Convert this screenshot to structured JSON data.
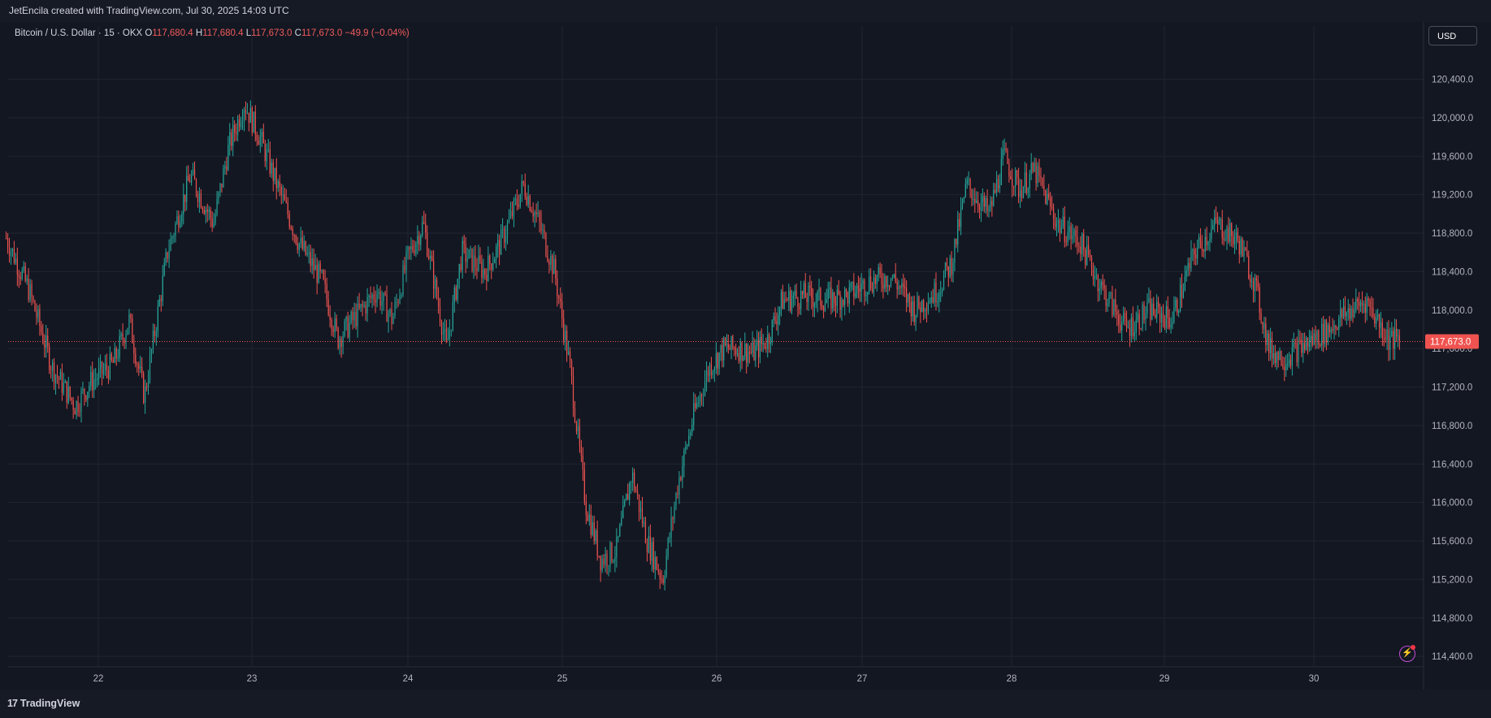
{
  "header": {
    "caption": "JetEncila created with TradingView.com, Jul 30, 2025 14:03 UTC"
  },
  "legend": {
    "symbol": "Bitcoin / U.S. Dollar · 15 · OKX",
    "o_label": "O",
    "o_value": "117,680.4",
    "h_label": "H",
    "h_value": "117,680.4",
    "l_label": "L",
    "l_value": "117,673.0",
    "c_label": "C",
    "c_value": "117,673.0",
    "change": "−49.9 (−0.04%)"
  },
  "currency_button": "USD",
  "footer": {
    "brand": "TradingView",
    "logo_glyph": "17"
  },
  "colors": {
    "up": "#26a69a",
    "down": "#ef5350",
    "background": "#131722",
    "grid": "#1f2431",
    "price_line": "#ef5350"
  },
  "icons": {
    "alert": "lightning-icon"
  },
  "chart_data": {
    "type": "candlestick",
    "title": "Bitcoin / U.S. Dollar · 15 · OKX",
    "x_ticks": [
      "22",
      "23",
      "24",
      "25",
      "26",
      "27",
      "28",
      "29",
      "30"
    ],
    "y_ticks": [
      "120,400.0",
      "120,000.0",
      "119,600.0",
      "119,200.0",
      "118,800.0",
      "118,400.0",
      "118,000.0",
      "117,600.0",
      "117,200.0",
      "116,800.0",
      "116,400.0",
      "116,000.0",
      "115,600.0",
      "115,200.0",
      "114,800.0",
      "114,400.0"
    ],
    "ylim": [
      114300,
      120700
    ],
    "last_price": 117673.0,
    "last_price_label": "117,673.0",
    "grid": true,
    "price_path": [
      {
        "day": 21.4,
        "price": 118750
      },
      {
        "day": 21.55,
        "price": 118200
      },
      {
        "day": 21.7,
        "price": 117400
      },
      {
        "day": 21.85,
        "price": 117000
      },
      {
        "day": 21.95,
        "price": 117250
      },
      {
        "day": 22.1,
        "price": 117450
      },
      {
        "day": 22.2,
        "price": 117900
      },
      {
        "day": 22.3,
        "price": 117100
      },
      {
        "day": 22.45,
        "price": 118600
      },
      {
        "day": 22.6,
        "price": 119400
      },
      {
        "day": 22.75,
        "price": 118900
      },
      {
        "day": 22.85,
        "price": 119700
      },
      {
        "day": 22.95,
        "price": 120150
      },
      {
        "day": 23.05,
        "price": 119800
      },
      {
        "day": 23.15,
        "price": 119350
      },
      {
        "day": 23.3,
        "price": 118700
      },
      {
        "day": 23.45,
        "price": 118300
      },
      {
        "day": 23.55,
        "price": 117700
      },
      {
        "day": 23.7,
        "price": 118000
      },
      {
        "day": 23.8,
        "price": 118200
      },
      {
        "day": 23.9,
        "price": 117900
      },
      {
        "day": 24.0,
        "price": 118550
      },
      {
        "day": 24.1,
        "price": 118900
      },
      {
        "day": 24.25,
        "price": 117600
      },
      {
        "day": 24.35,
        "price": 118600
      },
      {
        "day": 24.5,
        "price": 118400
      },
      {
        "day": 24.6,
        "price": 118700
      },
      {
        "day": 24.75,
        "price": 119300
      },
      {
        "day": 24.85,
        "price": 118900
      },
      {
        "day": 24.95,
        "price": 118400
      },
      {
        "day": 25.05,
        "price": 117400
      },
      {
        "day": 25.15,
        "price": 116000
      },
      {
        "day": 25.25,
        "price": 115400
      },
      {
        "day": 25.35,
        "price": 115500
      },
      {
        "day": 25.45,
        "price": 116300
      },
      {
        "day": 25.55,
        "price": 115600
      },
      {
        "day": 25.65,
        "price": 115200
      },
      {
        "day": 25.75,
        "price": 116200
      },
      {
        "day": 25.85,
        "price": 116900
      },
      {
        "day": 25.95,
        "price": 117400
      },
      {
        "day": 26.05,
        "price": 117600
      },
      {
        "day": 26.15,
        "price": 117600
      },
      {
        "day": 26.25,
        "price": 117550
      },
      {
        "day": 26.35,
        "price": 117700
      },
      {
        "day": 26.45,
        "price": 118100
      },
      {
        "day": 26.6,
        "price": 118150
      },
      {
        "day": 26.75,
        "price": 118100
      },
      {
        "day": 26.9,
        "price": 118150
      },
      {
        "day": 27.05,
        "price": 118300
      },
      {
        "day": 27.2,
        "price": 118350
      },
      {
        "day": 27.35,
        "price": 118000
      },
      {
        "day": 27.5,
        "price": 118200
      },
      {
        "day": 27.6,
        "price": 118500
      },
      {
        "day": 27.7,
        "price": 119300
      },
      {
        "day": 27.85,
        "price": 119000
      },
      {
        "day": 27.95,
        "price": 119600
      },
      {
        "day": 28.05,
        "price": 119250
      },
      {
        "day": 28.15,
        "price": 119450
      },
      {
        "day": 28.3,
        "price": 118900
      },
      {
        "day": 28.45,
        "price": 118700
      },
      {
        "day": 28.6,
        "price": 118200
      },
      {
        "day": 28.75,
        "price": 117800
      },
      {
        "day": 28.9,
        "price": 118000
      },
      {
        "day": 29.05,
        "price": 117900
      },
      {
        "day": 29.2,
        "price": 118600
      },
      {
        "day": 29.35,
        "price": 118900
      },
      {
        "day": 29.5,
        "price": 118700
      },
      {
        "day": 29.6,
        "price": 118300
      },
      {
        "day": 29.7,
        "price": 117600
      },
      {
        "day": 29.8,
        "price": 117500
      },
      {
        "day": 29.9,
        "price": 117600
      },
      {
        "day": 30.0,
        "price": 117700
      },
      {
        "day": 30.1,
        "price": 117800
      },
      {
        "day": 30.2,
        "price": 117950
      },
      {
        "day": 30.35,
        "price": 118100
      },
      {
        "day": 30.5,
        "price": 117700
      },
      {
        "day": 30.58,
        "price": 117673
      }
    ]
  }
}
